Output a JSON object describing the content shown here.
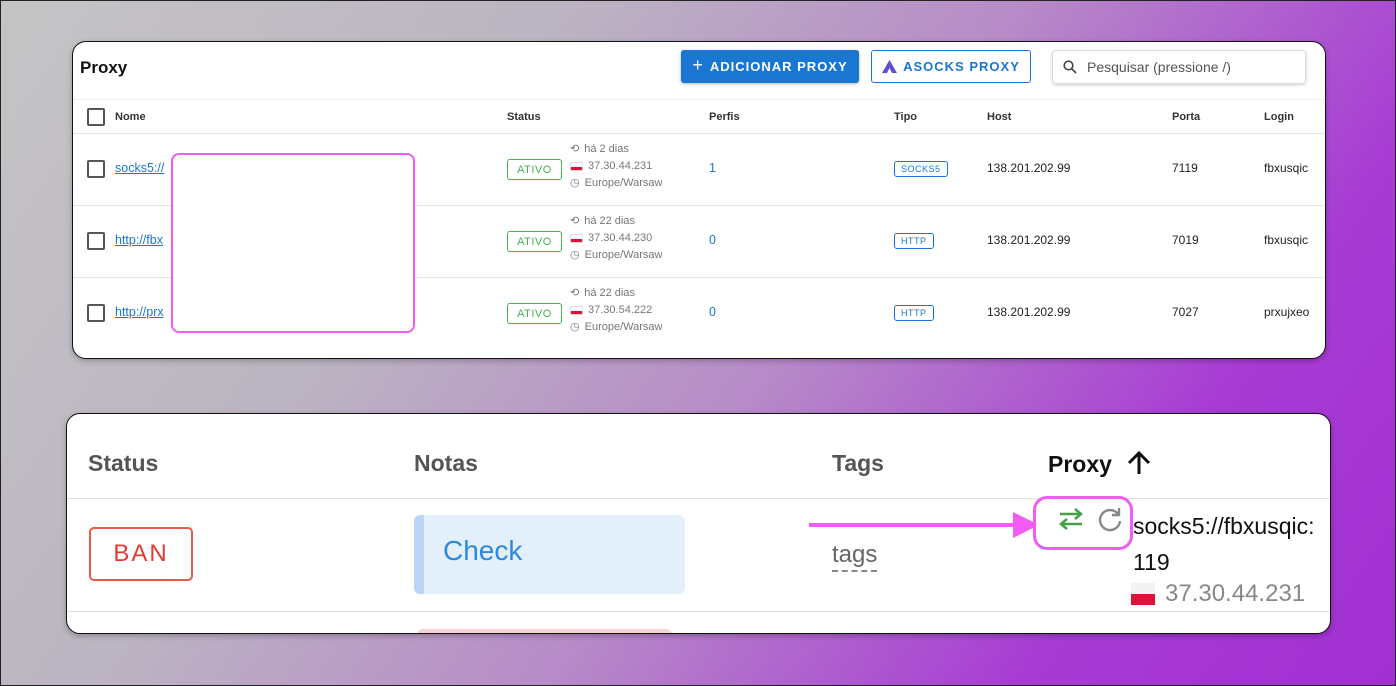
{
  "panel1": {
    "title": "Proxy",
    "add_button": "ADICIONAR PROXY",
    "asocks_button": "ASOCKS PROXY",
    "search_placeholder": "Pesquisar (pressione /)",
    "columns": {
      "name": "Nome",
      "status": "Status",
      "profiles": "Perfis",
      "type": "Tipo",
      "host": "Host",
      "port": "Porta",
      "login": "Login"
    },
    "rows": [
      {
        "name": "socks5://",
        "status": "ATIVO",
        "time": "há 2 dias",
        "ip": "37.30.44.231",
        "timezone": "Europe/Warsaw",
        "profiles": "1",
        "type": "SOCKS5",
        "host": "138.201.202.99",
        "port": "7119",
        "login": "fbxusqic"
      },
      {
        "name": "http://fbx",
        "status": "ATIVO",
        "time": "há 22 dias",
        "ip": "37.30.44.230",
        "timezone": "Europe/Warsaw",
        "profiles": "0",
        "type": "HTTP",
        "host": "138.201.202.99",
        "port": "7019",
        "login": "fbxusqic"
      },
      {
        "name": "http://prx",
        "status": "ATIVO",
        "time": "há 22 dias",
        "ip": "37.30.54.222",
        "timezone": "Europe/Warsaw",
        "profiles": "0",
        "type": "HTTP",
        "host": "138.201.202.99",
        "port": "7027",
        "login": "prxujxeo"
      }
    ]
  },
  "panel2": {
    "columns": {
      "status": "Status",
      "notes": "Notas",
      "tags": "Tags",
      "proxy": "Proxy"
    },
    "row": {
      "status": "BAN",
      "note": "Check",
      "tags": "tags",
      "proxy": "socks5://fbxusqic:\n119",
      "ip": "37.30.44.231"
    },
    "icons": [
      "swap-icon",
      "refresh-icon",
      "arrow-up-icon"
    ],
    "colors": {
      "highlight": "#f25cf2",
      "primary": "#1976d2",
      "active": "#4caf50",
      "ban": "#e53935"
    }
  }
}
